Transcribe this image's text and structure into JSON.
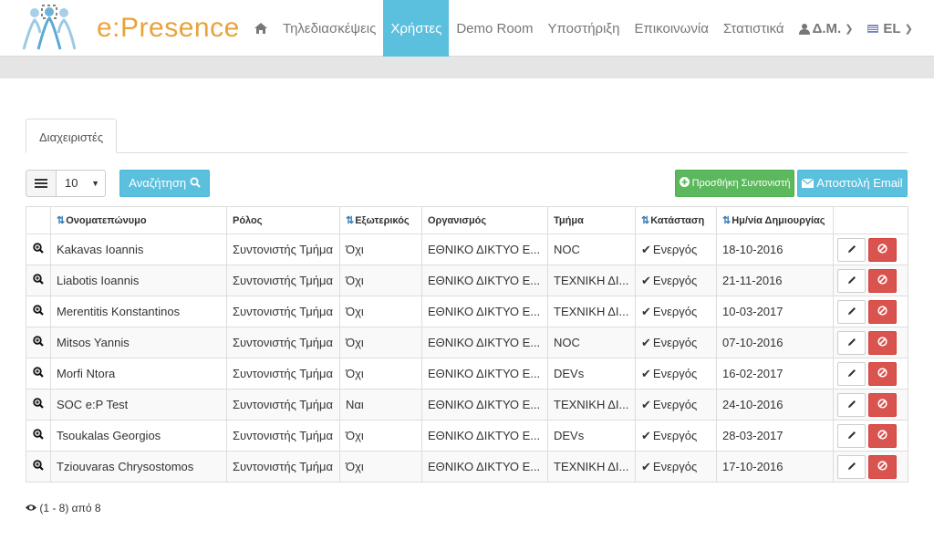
{
  "brand": {
    "prefix": "e:",
    "name": "Presence"
  },
  "nav": {
    "items": [
      {
        "label": "Τηλεδιασκέψεις",
        "active": false
      },
      {
        "label": "Χρήστες",
        "active": true
      },
      {
        "label": "Demo Room",
        "active": false
      },
      {
        "label": "Υποστήριξη",
        "active": false
      },
      {
        "label": "Επικοινωνία",
        "active": false
      },
      {
        "label": "Στατιστικά",
        "active": false
      }
    ],
    "user_label": "Δ.Μ.",
    "lang_label": "EL"
  },
  "tabs": [
    {
      "label": "Διαχειριστές",
      "active": true
    }
  ],
  "toolbar": {
    "page_size": "10",
    "search_label": "Αναζήτηση",
    "add_label": "Προσθήκη Συντονιστή",
    "email_label": "Αποστολή Email"
  },
  "table": {
    "headers": [
      "Ονοματεπώνυμο",
      "Ρόλος",
      "Εξωτερικός",
      "Οργανισμός",
      "Τμήμα",
      "Κατάσταση",
      "Ημ/νία Δημιουργίας"
    ],
    "rows": [
      {
        "name": "Kakavas Ioannis",
        "role": "Συντονιστής Τμήμα",
        "external": "Όχι",
        "org": "ΕΘΝΙΚΟ ΔΙΚΤΥΟ Ε...",
        "dept": "NOC",
        "status": "Ενεργός",
        "created": "18-10-2016"
      },
      {
        "name": "Liabotis Ioannis",
        "role": "Συντονιστής Τμήμα",
        "external": "Όχι",
        "org": "ΕΘΝΙΚΟ ΔΙΚΤΥΟ Ε...",
        "dept": "ΤΕΧΝΙΚΗ ΔΙ...",
        "status": "Ενεργός",
        "created": "21-11-2016"
      },
      {
        "name": "Merentitis Konstantinos",
        "role": "Συντονιστής Τμήμα",
        "external": "Όχι",
        "org": "ΕΘΝΙΚΟ ΔΙΚΤΥΟ Ε...",
        "dept": "ΤΕΧΝΙΚΗ ΔΙ...",
        "status": "Ενεργός",
        "created": "10-03-2017"
      },
      {
        "name": "Mitsos Yannis",
        "role": "Συντονιστής Τμήμα",
        "external": "Όχι",
        "org": "ΕΘΝΙΚΟ ΔΙΚΤΥΟ Ε...",
        "dept": "NOC",
        "status": "Ενεργός",
        "created": "07-10-2016"
      },
      {
        "name": "Morfi Ntora",
        "role": "Συντονιστής Τμήμα",
        "external": "Όχι",
        "org": "ΕΘΝΙΚΟ ΔΙΚΤΥΟ Ε...",
        "dept": "DEVs",
        "status": "Ενεργός",
        "created": "16-02-2017"
      },
      {
        "name": "SOC e:P Test",
        "role": "Συντονιστής Τμήμα",
        "external": "Ναι",
        "org": "ΕΘΝΙΚΟ ΔΙΚΤΥΟ Ε...",
        "dept": "ΤΕΧΝΙΚΗ ΔΙ...",
        "status": "Ενεργός",
        "created": "24-10-2016"
      },
      {
        "name": "Tsoukalas Georgios",
        "role": "Συντονιστής Τμήμα",
        "external": "Όχι",
        "org": "ΕΘΝΙΚΟ ΔΙΚΤΥΟ Ε...",
        "dept": "DEVs",
        "status": "Ενεργός",
        "created": "28-03-2017"
      },
      {
        "name": "Tziouvaras Chrysostomos",
        "role": "Συντονιστής Τμήμα",
        "external": "Όχι",
        "org": "ΕΘΝΙΚΟ ΔΙΚΤΥΟ Ε...",
        "dept": "ΤΕΧΝΙΚΗ ΔΙ...",
        "status": "Ενεργός",
        "created": "17-10-2016"
      }
    ]
  },
  "pagination": {
    "summary": "(1 - 8) από 8"
  },
  "colors": {
    "accent": "#5bc0de",
    "success": "#5cb85c",
    "danger": "#d9534f",
    "brand": "#f0a33a"
  }
}
